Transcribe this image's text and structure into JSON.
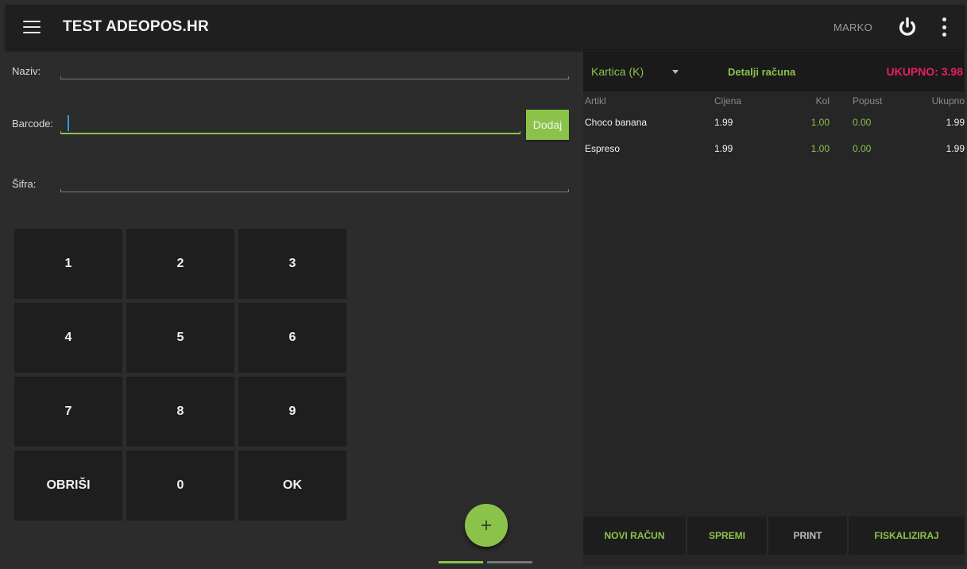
{
  "appbar": {
    "title": "TEST ADEOPOS.HR",
    "user": "MARKO",
    "menu_icon": "hamburger-menu-icon",
    "power_icon": "power-icon",
    "overflow_icon": "more-vert-icon"
  },
  "form": {
    "naziv": {
      "label": "Naziv:",
      "value": ""
    },
    "barcode": {
      "label": "Barcode:",
      "value": "",
      "add_label": "Dodaj"
    },
    "sifra": {
      "label": "Šifra:",
      "value": ""
    }
  },
  "numpad": {
    "keys": [
      "1",
      "2",
      "3",
      "4",
      "5",
      "6",
      "7",
      "8",
      "9",
      "OBRIŠI",
      "0",
      "OK"
    ]
  },
  "fab": {
    "icon": "plus-icon"
  },
  "bill": {
    "payment_method": "Kartica (K)",
    "details_label": "Detalji računa",
    "total": "UKUPNO: 3.98",
    "columns": {
      "article": "Artikl",
      "price": "Cijena",
      "qty": "Kol",
      "discount": "Popust",
      "total": "Ukupno"
    },
    "items": [
      {
        "article": "Choco banana",
        "price": "1.99",
        "qty": "1.00",
        "discount": "0.00",
        "total": "1.99"
      },
      {
        "article": "Espreso",
        "price": "1.99",
        "qty": "1.00",
        "discount": "0.00",
        "total": "1.99"
      }
    ]
  },
  "actions": {
    "new_bill": "NOVI RAČUN",
    "save": "SPREMI",
    "print": "PRINT",
    "fiscalize": "FISKALIZIRAJ"
  },
  "colors": {
    "accent": "#8bc34a",
    "total": "#e91e63",
    "appbar": "#1f1f1f",
    "background": "#2c2c2c"
  }
}
